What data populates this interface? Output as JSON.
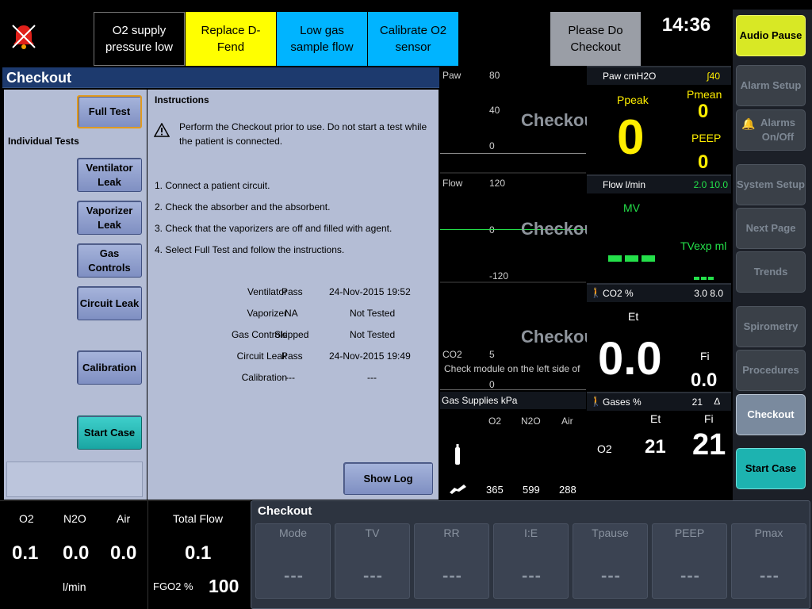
{
  "alarms": {
    "o2_supply": "O2 supply pressure low",
    "replace_dfend": "Replace D-Fend",
    "low_gas_sample": "Low gas sample flow",
    "calibrate_o2": "Calibrate O2 sensor",
    "please_checkout": "Please Do Checkout"
  },
  "clock": "14:36",
  "side_menu": {
    "audio_pause": "Audio Pause",
    "alarm_setup": "Alarm Setup",
    "alarms_onoff": "Alarms On/Off",
    "system_setup": "System Setup",
    "next_page": "Next Page",
    "trends": "Trends",
    "spirometry": "Spirometry",
    "procedures": "Procedures",
    "checkout": "Checkout",
    "start_case": "Start Case"
  },
  "checkout": {
    "title": "Checkout",
    "full_test": "Full Test",
    "individual_tests": "Individual Tests",
    "ventilator_leak": "Ventilator Leak",
    "vaporizer_leak": "Vaporizer Leak",
    "gas_controls": "Gas Controls",
    "circuit_leak": "Circuit Leak",
    "calibration": "Calibration",
    "start_case": "Start Case",
    "instructions_title": "Instructions",
    "warning": "Perform the Checkout prior to use. Do not start a test while the patient is connected.",
    "steps": [
      "1. Connect a patient circuit.",
      "2. Check the absorber and the absorbent.",
      "3. Check that the vaporizers are off and filled with agent.",
      "4. Select Full Test and follow the instructions."
    ],
    "results": [
      {
        "name": "Ventilator",
        "status": "Pass",
        "date": "24-Nov-2015 19:52"
      },
      {
        "name": "Vaporizer",
        "status": "NA",
        "date": "Not Tested"
      },
      {
        "name": "Gas Controls",
        "status": "Skipped",
        "date": "Not Tested"
      },
      {
        "name": "Circuit Leak",
        "status": "Pass",
        "date": "24-Nov-2015 19:49"
      },
      {
        "name": "Calibration",
        "status": "---",
        "date": "---"
      }
    ],
    "show_log": "Show Log"
  },
  "waves": {
    "paw_label": "Paw",
    "paw_top": "80",
    "paw_mid": "40",
    "paw_zero": "0",
    "flow_label": "Flow",
    "flow_top": "120",
    "flow_zero": "0",
    "flow_bottom": "-120",
    "co2_label": "CO2",
    "co2_top": "5",
    "co2_zero": "0",
    "co2_msg": "Check module on the left side of",
    "overlay": "Checkout",
    "gas_supplies": "Gas Supplies kPa",
    "gs_o2": "O2",
    "gs_n2o": "N2O",
    "gs_air": "Air",
    "gs_o2_val": "365",
    "gs_n2o_val": "599",
    "gs_air_val": "288"
  },
  "params": {
    "paw_title": "Paw cmH2O",
    "paw_limit": "40",
    "ppeak_label": "Ppeak",
    "ppeak": "0",
    "pmean_label": "Pmean",
    "pmean": "0",
    "peep_label": "PEEP",
    "peep": "0",
    "flow_title": "Flow l/min",
    "flow_limit": "2.0 10.0",
    "mv_label": "MV",
    "mv": "---",
    "tvexp_label": "TVexp ml",
    "tvexp": "---",
    "co2_title": "CO2 %",
    "co2_limit": "3.0 8.0",
    "et_label": "Et",
    "co2_et": "0.0",
    "fi_label": "Fi",
    "co2_fi": "0.0",
    "gases_title": "Gases %",
    "gases_limit": "21",
    "gases_et_label": "Et",
    "gases_fi_label": "Fi",
    "gas_o2_label": "O2",
    "gas_o2_et": "21",
    "gas_o2_fi": "21"
  },
  "flows": {
    "o2_label": "O2",
    "n2o_label": "N2O",
    "air_label": "Air",
    "o2": "0.1",
    "n2o": "0.0",
    "air": "0.0",
    "unit": "l/min",
    "total_label": "Total Flow",
    "total": "0.1",
    "fgo2_label": "FGO2 %",
    "fgo2": "100"
  },
  "vent": {
    "title": "Checkout",
    "settings": [
      {
        "label": "Mode",
        "value": "---"
      },
      {
        "label": "TV",
        "value": "---"
      },
      {
        "label": "RR",
        "value": "---"
      },
      {
        "label": "I:E",
        "value": "---"
      },
      {
        "label": "Tpause",
        "value": "---"
      },
      {
        "label": "PEEP",
        "value": "---"
      },
      {
        "label": "Pmax",
        "value": "---"
      }
    ]
  },
  "colors": {
    "yellow_alarm": "#ffff00",
    "cyan_alarm": "#00b4ff",
    "accent_green": "#24e04a",
    "value_yellow": "#ffee00"
  }
}
